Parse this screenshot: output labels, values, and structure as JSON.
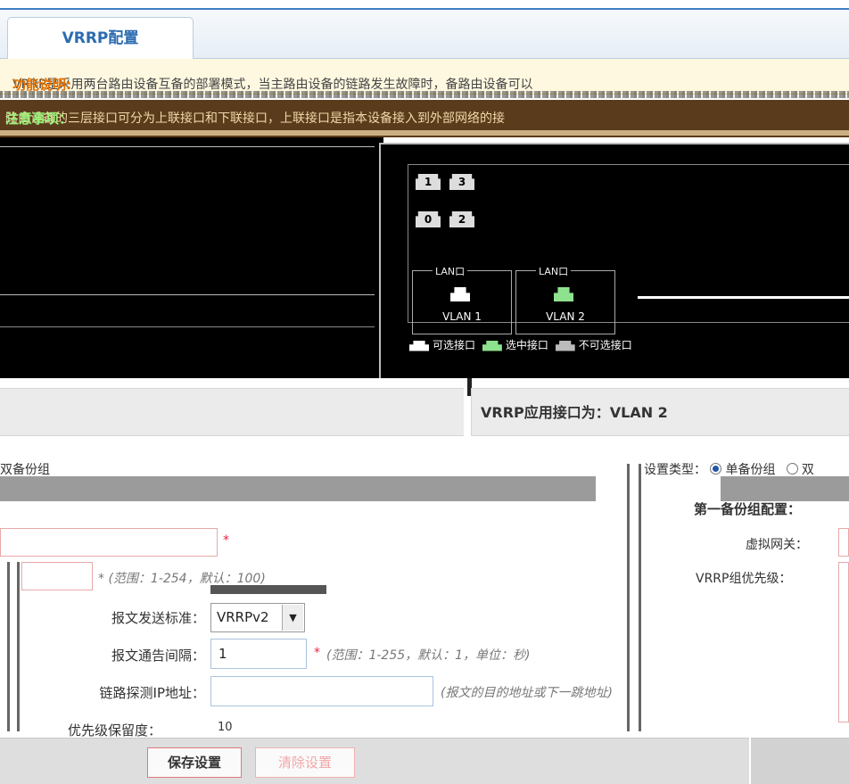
{
  "tabs": [
    {
      "label": "VRRP配置"
    }
  ],
  "notice1": {
    "label": "功能说明:",
    "text": " VRRP是采用两台路由设备互备的部署模式，当主路由设备的链路发生故障时，备路由设备可以"
  },
  "notice2": {
    "label": "注意事项：",
    "text": " 路由设备的三层接口可分为上联接口和下联接口，上联接口是指本设备接入到外部网络的接"
  },
  "ports": [
    {
      "label": "1"
    },
    {
      "label": "3"
    },
    {
      "label": "0"
    },
    {
      "label": "2"
    }
  ],
  "lan_groups": [
    {
      "caption": "LAN口",
      "vlan": "VLAN 1",
      "color": "#ffffff"
    },
    {
      "caption": "LAN口",
      "vlan": "VLAN 2",
      "color": "#8ee28e"
    }
  ],
  "legend": {
    "available": "可选接口",
    "selected": "选中接口",
    "unavailable": "不可选接口",
    "colors": {
      "available": "#ffffff",
      "selected": "#8ee28e",
      "unavailable": "#bbbbbb"
    }
  },
  "right_header": "VRRP应用接口为：VLAN 2",
  "left_fragment": {
    "group_text": "双备份组",
    "hint_priority": "* (范围：1-254，默认：100)"
  },
  "right_form": {
    "type_label": "设置类型：",
    "single_label": "单备份组",
    "dual_label": "双",
    "group_title": "第一备份组配置：",
    "gateway_label": "虚拟网关：",
    "priority_label": "VRRP组优先级："
  },
  "form": {
    "standard_label": "报文发送标准：",
    "standard_value": "VRRPv2",
    "interval_label": "报文通告间隔：",
    "interval_value": "1",
    "interval_hint": "(范围：1-255，默认：1，单位：秒)",
    "probe_label": "链路探测IP地址：",
    "probe_value": "",
    "probe_hint": "(报文的目的地址或下一跳地址)",
    "partial_label": "优先级保留度：",
    "partial_value": "10"
  },
  "buttons": {
    "save": "保存设置",
    "clear": "清除设置"
  }
}
